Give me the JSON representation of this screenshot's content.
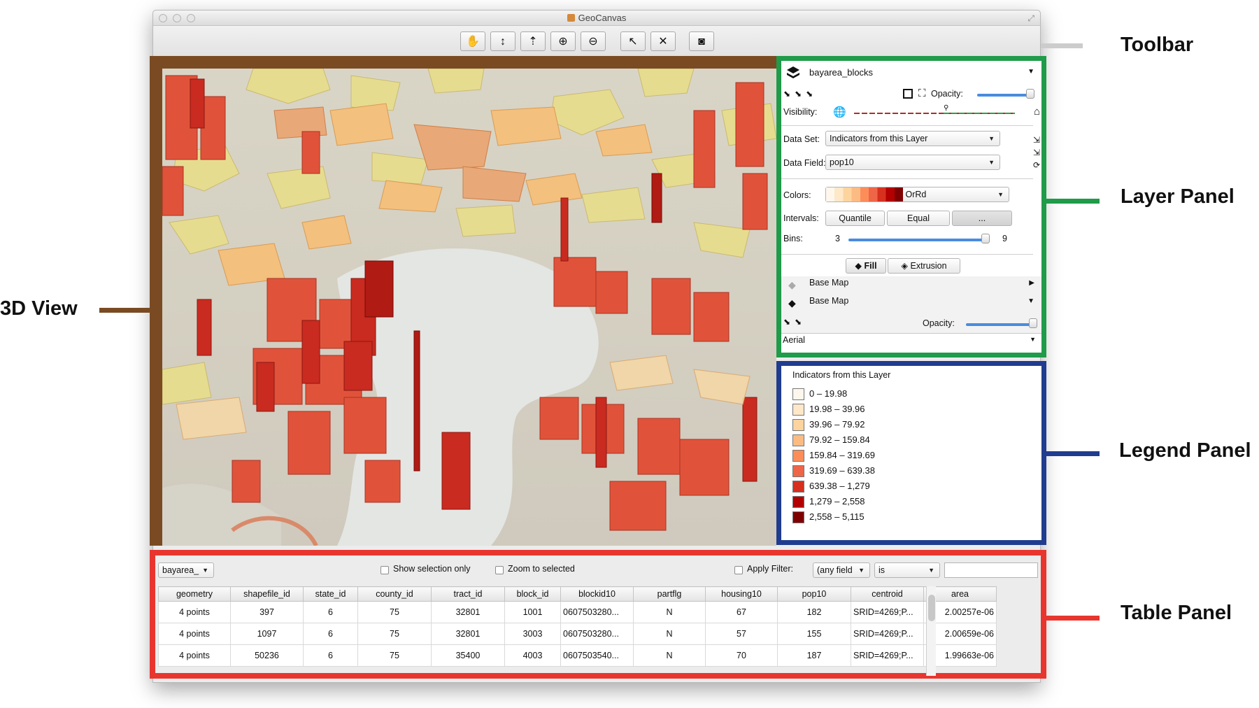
{
  "window": {
    "title": "GeoCanvas"
  },
  "toolbar": {
    "buttons": [
      {
        "name": "pan-tool",
        "icon": "hand-icon",
        "glyph": "✋"
      },
      {
        "name": "height-tool",
        "icon": "vertical-arrows-icon",
        "glyph": "↕"
      },
      {
        "name": "tilt-tool",
        "icon": "arrow-up-icon",
        "glyph": "⇡"
      },
      {
        "name": "zoom-in-tool",
        "icon": "zoom-in-icon",
        "glyph": "⊕"
      },
      {
        "name": "zoom-out-tool",
        "icon": "zoom-out-icon",
        "glyph": "⊖"
      },
      {
        "name": "select-tool",
        "icon": "select-pointer-icon",
        "glyph": "↖"
      },
      {
        "name": "clear-selection-tool",
        "icon": "clear-selection-icon",
        "glyph": "✕"
      },
      {
        "name": "screenshot-tool",
        "icon": "camera-icon",
        "glyph": "◙"
      }
    ]
  },
  "callouts": {
    "toolbar": "Toolbar",
    "layer_panel": "Layer Panel",
    "view3d": "3D View",
    "legend_panel": "Legend Panel",
    "table_panel": "Table Panel",
    "colors": {
      "toolbar": "#cccccc",
      "layer_panel": "#1f9b4a",
      "view3d": "#7a4b23",
      "legend_panel": "#203c8f",
      "table_panel": "#e8362e"
    }
  },
  "layer_panel": {
    "layer_name": "bayarea_blocks",
    "opacity_label": "Opacity:",
    "opacity_value": 0.95,
    "visibility_label": "Visibility:",
    "data_set_label": "Data Set:",
    "data_set_value": "Indicators from this Layer",
    "data_field_label": "Data Field:",
    "data_field_value": "pop10",
    "colors_label": "Colors:",
    "colors_value": "OrRd",
    "intervals_label": "Intervals:",
    "interval_quantile": "Quantile",
    "interval_equal": "Equal",
    "interval_more": "...",
    "bins_label": "Bins:",
    "bins_min": "3",
    "bins_max": "9",
    "bins_value_fraction": 1.0,
    "tab_fill": "Fill",
    "tab_extrusion": "Extrusion",
    "base_map_1": "Base Map",
    "base_map_2": "Base Map",
    "base_opacity_label": "Opacity:",
    "base_opacity_value": 1.0,
    "base_style": "Aerial"
  },
  "legend": {
    "title": "Indicators from this Layer",
    "items": [
      {
        "label": "0 – 19.98",
        "color": "#fff7ec"
      },
      {
        "label": "19.98 – 39.96",
        "color": "#fee8c8"
      },
      {
        "label": "39.96 – 79.92",
        "color": "#fdd49e"
      },
      {
        "label": "79.92 – 159.84",
        "color": "#fdbb84"
      },
      {
        "label": "159.84 – 319.69",
        "color": "#fc8d59"
      },
      {
        "label": "319.69 – 639.38",
        "color": "#ef6548"
      },
      {
        "label": "639.38 – 1,279",
        "color": "#d7301f"
      },
      {
        "label": "1,279 – 2,558",
        "color": "#b30000"
      },
      {
        "label": "2,558 – 5,115",
        "color": "#7f0000"
      }
    ]
  },
  "table_panel": {
    "layer_select": "bayarea_",
    "show_selection_only": "Show selection only",
    "zoom_to_selected": "Zoom to selected",
    "apply_filter": "Apply Filter:",
    "filter_field": "(any field",
    "filter_op": "is",
    "filter_value": "",
    "columns": [
      "geometry",
      "shapefile_id",
      "state_id",
      "county_id",
      "tract_id",
      "block_id",
      "blockid10",
      "partflg",
      "housing10",
      "pop10",
      "centroid",
      "area"
    ],
    "rows": [
      [
        "4 points",
        "397",
        "6",
        "75",
        "32801",
        "1001",
        "0607503280...",
        "N",
        "67",
        "182",
        "SRID=4269;P...",
        "2.00257e-06"
      ],
      [
        "4 points",
        "1097",
        "6",
        "75",
        "32801",
        "3003",
        "0607503280...",
        "N",
        "57",
        "155",
        "SRID=4269;P...",
        "2.00659e-06"
      ],
      [
        "4 points",
        "50236",
        "6",
        "75",
        "35400",
        "4003",
        "0607503540...",
        "N",
        "70",
        "187",
        "SRID=4269;P...",
        "1.99663e-06"
      ]
    ]
  }
}
